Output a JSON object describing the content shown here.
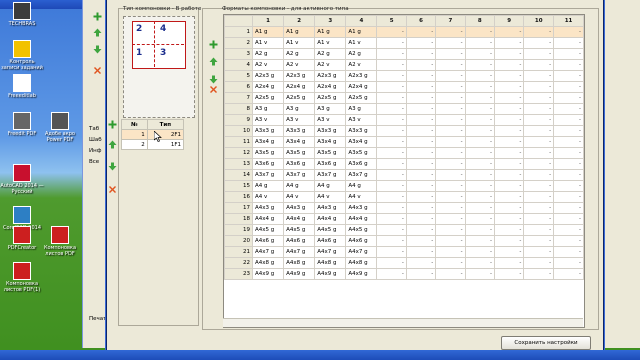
{
  "desktop": {
    "icons": [
      {
        "label": "TECHBRAS",
        "icon": "desktop-folder-icon",
        "color": "#3c3c3c"
      },
      {
        "label": "Контроль записи заданий",
        "icon": "settings-lightning-icon",
        "color": "#f2c200"
      },
      {
        "label": "Freeeditlab",
        "icon": "rw-disc-icon",
        "color": "#ffffff"
      },
      {
        "label": "Freedit PDF",
        "icon": "printer-icon",
        "color": "#666666"
      },
      {
        "label": "AutoCAD 2014 — Русский",
        "icon": "autocad-icon",
        "color": "#c8102e"
      },
      {
        "label": "CorelCAD 2014",
        "icon": "corelcad-icon",
        "color": "#2d7fc4"
      },
      {
        "label": "PDFCreator",
        "icon": "pdfcreator-icon",
        "color": "#cc1f1f"
      },
      {
        "label": "Компоновка листов PDF(1)",
        "icon": "pdf-file-icon",
        "color": "#cc1f1f"
      }
    ],
    "icons_col2": [
      {
        "label": "Адобе акро Power PDF",
        "icon": "printer2-icon"
      },
      {
        "label": "Компоновка листов PDF",
        "icon": "pdf-file2-icon"
      }
    ]
  },
  "background_window": {
    "labels": [
      "Таб",
      "Шаб",
      "Инф",
      "Все",
      "Печат"
    ]
  },
  "dialog": {
    "type_panel": {
      "title": "Тип компоновки - В работе",
      "preview_numbers": [
        "2",
        "4",
        "1",
        "3"
      ],
      "list": {
        "headers": [
          "№",
          "Тип"
        ],
        "rows": [
          [
            "1",
            "2F1"
          ],
          [
            "2",
            "1F1"
          ]
        ]
      }
    },
    "formats_panel": {
      "title": "Форматы компоновки - для активного типа",
      "columns": [
        "",
        "1",
        "2",
        "3",
        "4",
        "5",
        "6",
        "7",
        "8",
        "9",
        "10",
        "11"
      ],
      "rows": [
        [
          "1",
          "A1 g",
          "A1 g",
          "A1 g",
          "A1 g"
        ],
        [
          "2",
          "A1 v",
          "A1 v",
          "A1 v",
          "A1 v"
        ],
        [
          "3",
          "A2 g",
          "A2 g",
          "A2 g",
          "A2 g"
        ],
        [
          "4",
          "A2 v",
          "A2 v",
          "A2 v",
          "A2 v"
        ],
        [
          "5",
          "A2x3 g",
          "A2x3 g",
          "A2x3 g",
          "A2x3 g"
        ],
        [
          "6",
          "A2x4 g",
          "A2x4 g",
          "A2x4 g",
          "A2x4 g"
        ],
        [
          "7",
          "A2x5 g",
          "A2x5 g",
          "A2x5 g",
          "A2x5 g"
        ],
        [
          "8",
          "A3 g",
          "A3 g",
          "A3 g",
          "A3 g"
        ],
        [
          "9",
          "A3 v",
          "A3 v",
          "A3 v",
          "A3 v"
        ],
        [
          "10",
          "A3x3 g",
          "A3x3 g",
          "A3x3 g",
          "A3x3 g"
        ],
        [
          "11",
          "A3x4 g",
          "A3x4 g",
          "A3x4 g",
          "A3x4 g"
        ],
        [
          "12",
          "A3x5 g",
          "A3x5 g",
          "A3x5 g",
          "A3x5 g"
        ],
        [
          "13",
          "A3x6 g",
          "A3x6 g",
          "A3x6 g",
          "A3x6 g"
        ],
        [
          "14",
          "A3x7 g",
          "A3x7 g",
          "A3x7 g",
          "A3x7 g"
        ],
        [
          "15",
          "A4 g",
          "A4 g",
          "A4 g",
          "A4 g"
        ],
        [
          "16",
          "A4 v",
          "A4 v",
          "A4 v",
          "A4 v"
        ],
        [
          "17",
          "A4x3 g",
          "A4x3 g",
          "A4x3 g",
          "A4x3 g"
        ],
        [
          "18",
          "A4x4 g",
          "A4x4 g",
          "A4x4 g",
          "A4x4 g"
        ],
        [
          "19",
          "A4x5 g",
          "A4x5 g",
          "A4x5 g",
          "A4x5 g"
        ],
        [
          "20",
          "A4x6 g",
          "A4x6 g",
          "A4x6 g",
          "A4x6 g"
        ],
        [
          "21",
          "A4x7 g",
          "A4x7 g",
          "A4x7 g",
          "A4x7 g"
        ],
        [
          "22",
          "A4x8 g",
          "A4x8 g",
          "A4x8 g",
          "A4x8 g"
        ],
        [
          "23",
          "A4x9 g",
          "A4x9 g",
          "A4x9 g",
          "A4x9 g"
        ]
      ],
      "empty_cell": "-",
      "selected_row": 1
    },
    "toolbar_icons": [
      "add-icon",
      "move-up-icon",
      "move-down-icon",
      "delete-icon"
    ],
    "save_button": "Сохранить настройки"
  },
  "colors": {
    "add": "#2e9a2e",
    "arrow": "#3fa53f",
    "delete": "#e0541f",
    "selected_row": "#fbe5c6"
  }
}
